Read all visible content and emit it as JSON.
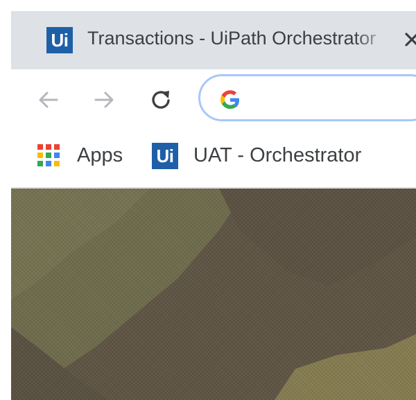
{
  "tab": {
    "title": "Transactions - UiPath Orchestrator",
    "favicon_text": "Ui",
    "favicon_color": "#1f5fa8",
    "close_icon": "close-icon"
  },
  "toolbar": {
    "back_icon": "back-arrow-icon",
    "forward_icon": "forward-arrow-icon",
    "reload_icon": "reload-icon",
    "omnibox_value": "",
    "omnibox_icon": "google-icon"
  },
  "bookmarks": {
    "items": [
      {
        "label": "Apps",
        "icon": "apps-grid-icon"
      },
      {
        "label": "UAT - Orchestrator",
        "icon": "uipath-icon",
        "icon_text": "Ui"
      }
    ]
  },
  "colors": {
    "tabstrip": "#dee1e6",
    "omnibox_border": "#a8c7fa",
    "camo_light": "#74704f",
    "camo_dark": "#5e5444",
    "camo_tan": "#8a8052"
  }
}
